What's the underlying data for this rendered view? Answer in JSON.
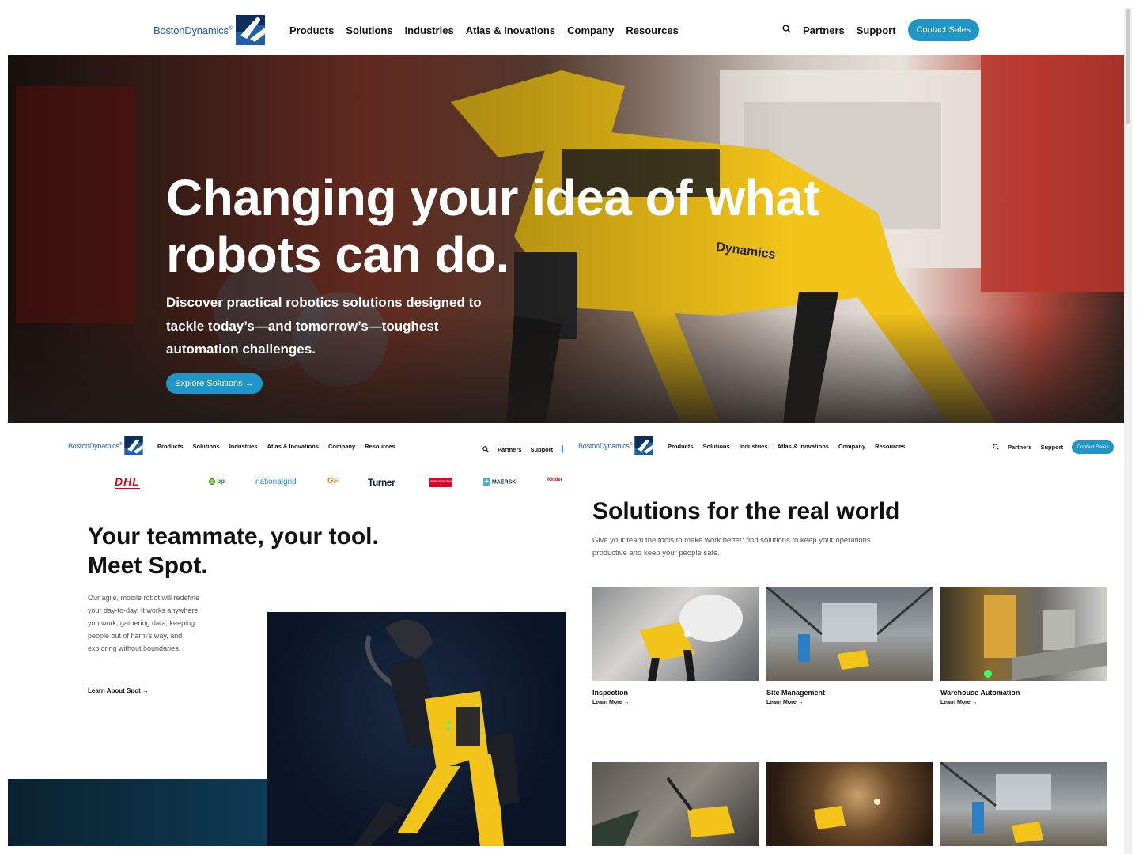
{
  "brand": {
    "name": "BostonDynamics",
    "trademark": "®",
    "accent_color": "#1e96c8",
    "logo_color": "#1f5fa8"
  },
  "header": {
    "nav": [
      "Products",
      "Solutions",
      "Industries",
      "Atlas & Inovations",
      "Company",
      "Resources"
    ],
    "search_icon": "search-icon",
    "partners": "Partners",
    "support": "Support",
    "contact": "Contact Sales"
  },
  "hero": {
    "title": "Changing your idea of what robots can do.",
    "subtitle": "Discover practical robotics solutions designed to tackle today’s—and tomorrow’s—toughest automation challenges.",
    "cta": "Explore Solutions →",
    "robot_badge": "Dynamics"
  },
  "partners_logos": [
    "DHL",
    "bp",
    "nationalgrid",
    "GF",
    "Turner",
    "Ontario Power Generation",
    "MAERSK",
    "Kinder"
  ],
  "spot": {
    "title": "Your teammate, your tool. Meet Spot.",
    "body": "Our agile, mobile robot will redefine your day-to-day. It works anywhere you work, gathering data, keeping people out of harm’s way, and exploring without boundaries.",
    "link": "Learn About Spot →"
  },
  "solutions": {
    "title": "Solutions for the real world",
    "subtitle": "Give your team the tools to make work better: find solutions to keep your operations productive and keep your people safe.",
    "cards": [
      {
        "title": "Inspection",
        "link": "Learn More →"
      },
      {
        "title": "Site Management",
        "link": "Learn More →"
      },
      {
        "title": "Warehouse Automation",
        "link": "Learn More →"
      }
    ]
  }
}
